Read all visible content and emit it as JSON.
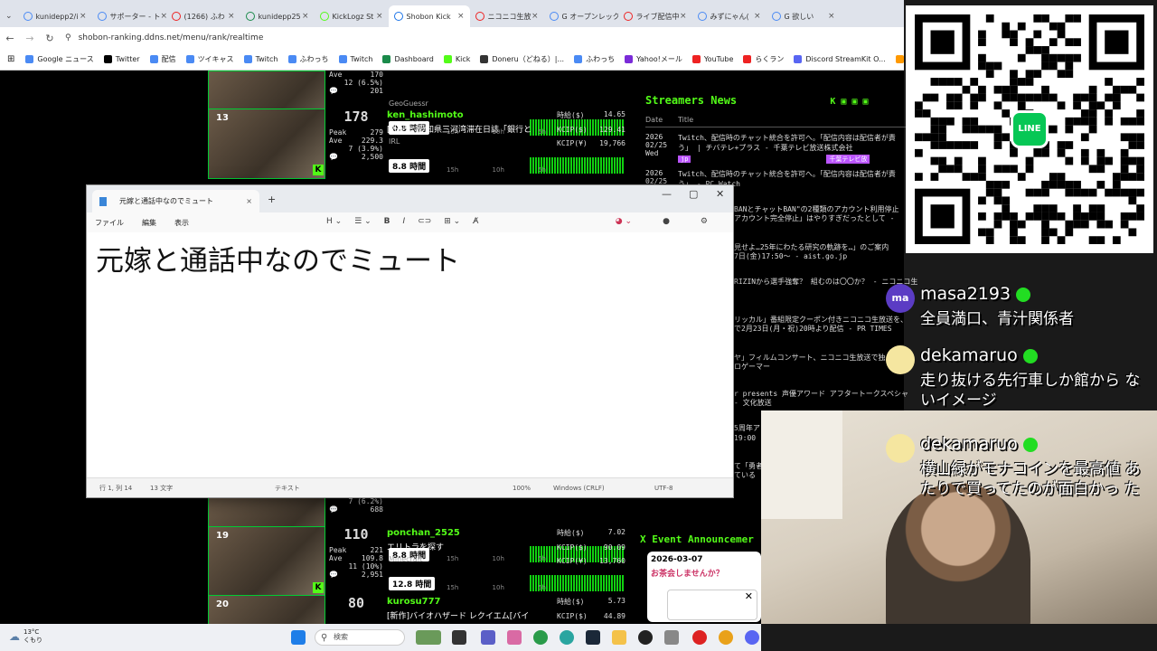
{
  "browser": {
    "tabs": [
      {
        "label": "kunidepp2/i",
        "color": "#4a8af4"
      },
      {
        "label": "サポーター - ト",
        "color": "#4a8af4"
      },
      {
        "label": "(1266) ふわ",
        "color": "#e22"
      },
      {
        "label": "kunidepp25",
        "color": "#1a8a4a"
      },
      {
        "label": "KickLogz St",
        "color": "#53fc18"
      },
      {
        "label": "Shobon Kick",
        "color": "#1a73e8",
        "active": true
      },
      {
        "label": "ニコニコ生放",
        "color": "#e22"
      },
      {
        "label": "G オープンレック",
        "color": "#4a8af4"
      },
      {
        "label": "ライブ配信中",
        "color": "#e22"
      },
      {
        "label": "みずにゃん(",
        "color": "#4a8af4"
      },
      {
        "label": "G 欲しい",
        "color": "#4a8af4"
      }
    ],
    "url": "shobon-ranking.ddns.net/menu/rank/realtime",
    "bookmarks": [
      {
        "label": "Google ニュース",
        "color": "#4a8af4"
      },
      {
        "label": "Twitter",
        "color": "#000"
      },
      {
        "label": "配信",
        "color": "#4a8af4"
      },
      {
        "label": "ツイキャス",
        "color": "#4a8af4"
      },
      {
        "label": "Twitch",
        "color": "#4a8af4"
      },
      {
        "label": "ふわっち",
        "color": "#4a8af4"
      },
      {
        "label": "Twitch",
        "color": "#4a8af4"
      },
      {
        "label": "Dashboard",
        "color": "#1a8a4a"
      },
      {
        "label": "Kick",
        "color": "#53fc18"
      },
      {
        "label": "Doneru（どねる）|...",
        "color": "#333"
      },
      {
        "label": "ふわっち",
        "color": "#4a8af4"
      },
      {
        "label": "Yahoo!メール",
        "color": "#7a2bd8"
      },
      {
        "label": "YouTube",
        "color": "#e22"
      },
      {
        "label": "らくラン",
        "color": "#e22"
      },
      {
        "label": "Discord StreamKit O...",
        "color": "#5865f2"
      },
      {
        "label": "mixi",
        "color": "#f90"
      },
      {
        "label": "Sh",
        "color": "#4a8af4"
      }
    ]
  },
  "ranking": [
    {
      "rank": "",
      "viewers": "",
      "peak": "",
      "ave": "170",
      "pct": "12 (6.5%)",
      "chat": "201",
      "name": "",
      "title": "",
      "tag": "GeoGuessr",
      "hours": "0.8 時間",
      "jikyu": "",
      "kcip_yen": "",
      "kcip": "",
      "axis": [
        "15h",
        "10h",
        "5h"
      ]
    },
    {
      "rank": "13",
      "viewers": "178",
      "peak": "279",
      "ave": "229.3",
      "pct": "7 (3.9%)",
      "chat": "2,500",
      "name": "ken_hashimoto",
      "title": "[外配信]愛知県三河湾滞在日誌「銀行と",
      "tag": "IRL",
      "hours": "8.8 時間",
      "jikyu": "14.65",
      "kcip_yen": "129.41",
      "kcip": "19,766",
      "axis": [
        "15h",
        "10h",
        "5h"
      ]
    },
    {
      "rank": "",
      "viewers": "",
      "peak": "",
      "ave": "",
      "pct": "7 (6.2%)",
      "chat": "688",
      "name": "",
      "title": "",
      "tag": "",
      "hours": "8.8 時間",
      "jikyu": "",
      "kcip_yen": "",
      "kcip": "",
      "axis": [
        "15h",
        "10h",
        "5h"
      ]
    },
    {
      "rank": "19",
      "viewers": "110",
      "peak": "221",
      "ave": "109.8",
      "pct": "11 (10%)",
      "chat": "2,951",
      "name": "ponchan_2525",
      "title": "エリトラを探す",
      "tag": "Minecraft",
      "hours": "12.8 時間",
      "jikyu": "7.02",
      "kcip_yen": "90.09",
      "kcip": "13,760",
      "axis": [
        "15h",
        "10h",
        "5h"
      ]
    },
    {
      "rank": "20",
      "viewers": "80",
      "peak": "",
      "ave": "",
      "pct": "",
      "chat": "",
      "name": "kurosu777",
      "title": "[新作]バイオハザード レクイエム[バイ",
      "tag": "",
      "hours": "",
      "jikyu": "5.73",
      "kcip_yen": "44.89",
      "kcip": "",
      "axis": []
    }
  ],
  "labels": {
    "peak": "Peak",
    "ave": "Ave",
    "jikyu": "時給($)",
    "kcip_yen": "KCIP($)",
    "kcip": "KCIP(¥)",
    "s10": "$ 10"
  },
  "news": {
    "heading": "Streamers News",
    "col_date": "Date",
    "col_title": "Title",
    "items": [
      {
        "date": "2026 02/25 Wed",
        "title": "Twitch、配信時のチャット統合を許可へ。「配信内容は配信者が責",
        "title2": "う」 | チバテレ+プラス - 千葉テレビ放送株式会社",
        "src": "jp",
        "badge": "千葉テレビ放"
      },
      {
        "date": "2026 02/25",
        "title": "Twitch、配信時のチャット統合を許可へ。「配信内容は配信者が責",
        "title2": "う」 - PC Watch",
        "src": "",
        "badge": ""
      }
    ],
    "fragments": [
      "BANとチャットBAN\"の2種類のアカウント利用停止",
      "アカウント完全停止」はやりすぎだったとして -",
      "見せよ…25年にわたる研究の軌跡を…」のご案内",
      "7日(金)17:50～ - aist.go.jp",
      "RIZINから選手強奪？ 組むのは〇〇か？ - ニコニコ生",
      "リッカル」番組限定クーポン付きニコニコ生放送を、",
      "で2月23日(月・祝)20時より配信 - PR TIMES",
      "ヤ」フィルムコンサート、ニコニコ生放送で独占",
      "ロゲーマー",
      "r presents 声優アワード アフタートークスペシャ",
      "- 文化放送",
      "5周年ア",
      "19:00",
      "て「勇者",
      "ている"
    ]
  },
  "x_event": {
    "heading": "X Event Announcemer",
    "date": "2026-03-07",
    "invite": "お茶会しませんか？"
  },
  "notepad": {
    "tab_title": "元嫁と通話中なのでミュート",
    "menu": [
      "ファイル",
      "編集",
      "表示"
    ],
    "content": "元嫁と通話中なのでミュート",
    "status": {
      "pos": "行 1, 列 14",
      "chars": "13 文字",
      "mode": "テキスト",
      "zoom": "100%",
      "eol": "Windows (CRLF)",
      "enc": "UTF-8"
    }
  },
  "qr": {
    "logo": "LINE"
  },
  "chat": [
    {
      "user": "masa2193",
      "avatar": "ma",
      "avatar_color": "#5b3cc4",
      "text": "全員満口、青汁関係者"
    },
    {
      "user": "dekamaruo",
      "avatar": "",
      "avatar_color": "#f5e6a0",
      "text": "走り抜ける先行車しか館から ないイメージ"
    },
    {
      "user": "dekamaruo",
      "avatar": "",
      "avatar_color": "#f5e6a0",
      "text": "横山緑がモナコインを最高値 あたりで買ってたのが面白かっ た"
    }
  ],
  "taskbar": {
    "temp": "13°C",
    "weather": "くもり",
    "search_placeholder": "検索"
  }
}
